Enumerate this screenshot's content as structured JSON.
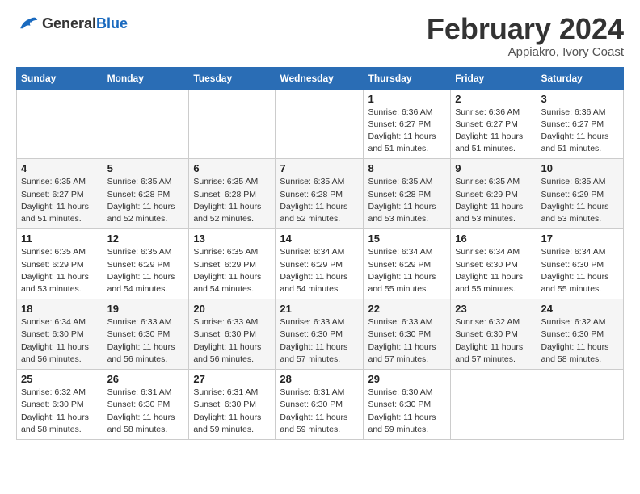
{
  "header": {
    "logo_line1": "General",
    "logo_line2": "Blue",
    "month": "February 2024",
    "location": "Appiakro, Ivory Coast"
  },
  "days_of_week": [
    "Sunday",
    "Monday",
    "Tuesday",
    "Wednesday",
    "Thursday",
    "Friday",
    "Saturday"
  ],
  "weeks": [
    [
      {
        "day": "",
        "detail": ""
      },
      {
        "day": "",
        "detail": ""
      },
      {
        "day": "",
        "detail": ""
      },
      {
        "day": "",
        "detail": ""
      },
      {
        "day": "1",
        "detail": "Sunrise: 6:36 AM\nSunset: 6:27 PM\nDaylight: 11 hours and 51 minutes."
      },
      {
        "day": "2",
        "detail": "Sunrise: 6:36 AM\nSunset: 6:27 PM\nDaylight: 11 hours and 51 minutes."
      },
      {
        "day": "3",
        "detail": "Sunrise: 6:36 AM\nSunset: 6:27 PM\nDaylight: 11 hours and 51 minutes."
      }
    ],
    [
      {
        "day": "4",
        "detail": "Sunrise: 6:35 AM\nSunset: 6:27 PM\nDaylight: 11 hours and 51 minutes."
      },
      {
        "day": "5",
        "detail": "Sunrise: 6:35 AM\nSunset: 6:28 PM\nDaylight: 11 hours and 52 minutes."
      },
      {
        "day": "6",
        "detail": "Sunrise: 6:35 AM\nSunset: 6:28 PM\nDaylight: 11 hours and 52 minutes."
      },
      {
        "day": "7",
        "detail": "Sunrise: 6:35 AM\nSunset: 6:28 PM\nDaylight: 11 hours and 52 minutes."
      },
      {
        "day": "8",
        "detail": "Sunrise: 6:35 AM\nSunset: 6:28 PM\nDaylight: 11 hours and 53 minutes."
      },
      {
        "day": "9",
        "detail": "Sunrise: 6:35 AM\nSunset: 6:29 PM\nDaylight: 11 hours and 53 minutes."
      },
      {
        "day": "10",
        "detail": "Sunrise: 6:35 AM\nSunset: 6:29 PM\nDaylight: 11 hours and 53 minutes."
      }
    ],
    [
      {
        "day": "11",
        "detail": "Sunrise: 6:35 AM\nSunset: 6:29 PM\nDaylight: 11 hours and 53 minutes."
      },
      {
        "day": "12",
        "detail": "Sunrise: 6:35 AM\nSunset: 6:29 PM\nDaylight: 11 hours and 54 minutes."
      },
      {
        "day": "13",
        "detail": "Sunrise: 6:35 AM\nSunset: 6:29 PM\nDaylight: 11 hours and 54 minutes."
      },
      {
        "day": "14",
        "detail": "Sunrise: 6:34 AM\nSunset: 6:29 PM\nDaylight: 11 hours and 54 minutes."
      },
      {
        "day": "15",
        "detail": "Sunrise: 6:34 AM\nSunset: 6:29 PM\nDaylight: 11 hours and 55 minutes."
      },
      {
        "day": "16",
        "detail": "Sunrise: 6:34 AM\nSunset: 6:30 PM\nDaylight: 11 hours and 55 minutes."
      },
      {
        "day": "17",
        "detail": "Sunrise: 6:34 AM\nSunset: 6:30 PM\nDaylight: 11 hours and 55 minutes."
      }
    ],
    [
      {
        "day": "18",
        "detail": "Sunrise: 6:34 AM\nSunset: 6:30 PM\nDaylight: 11 hours and 56 minutes."
      },
      {
        "day": "19",
        "detail": "Sunrise: 6:33 AM\nSunset: 6:30 PM\nDaylight: 11 hours and 56 minutes."
      },
      {
        "day": "20",
        "detail": "Sunrise: 6:33 AM\nSunset: 6:30 PM\nDaylight: 11 hours and 56 minutes."
      },
      {
        "day": "21",
        "detail": "Sunrise: 6:33 AM\nSunset: 6:30 PM\nDaylight: 11 hours and 57 minutes."
      },
      {
        "day": "22",
        "detail": "Sunrise: 6:33 AM\nSunset: 6:30 PM\nDaylight: 11 hours and 57 minutes."
      },
      {
        "day": "23",
        "detail": "Sunrise: 6:32 AM\nSunset: 6:30 PM\nDaylight: 11 hours and 57 minutes."
      },
      {
        "day": "24",
        "detail": "Sunrise: 6:32 AM\nSunset: 6:30 PM\nDaylight: 11 hours and 58 minutes."
      }
    ],
    [
      {
        "day": "25",
        "detail": "Sunrise: 6:32 AM\nSunset: 6:30 PM\nDaylight: 11 hours and 58 minutes."
      },
      {
        "day": "26",
        "detail": "Sunrise: 6:31 AM\nSunset: 6:30 PM\nDaylight: 11 hours and 58 minutes."
      },
      {
        "day": "27",
        "detail": "Sunrise: 6:31 AM\nSunset: 6:30 PM\nDaylight: 11 hours and 59 minutes."
      },
      {
        "day": "28",
        "detail": "Sunrise: 6:31 AM\nSunset: 6:30 PM\nDaylight: 11 hours and 59 minutes."
      },
      {
        "day": "29",
        "detail": "Sunrise: 6:30 AM\nSunset: 6:30 PM\nDaylight: 11 hours and 59 minutes."
      },
      {
        "day": "",
        "detail": ""
      },
      {
        "day": "",
        "detail": ""
      }
    ]
  ]
}
